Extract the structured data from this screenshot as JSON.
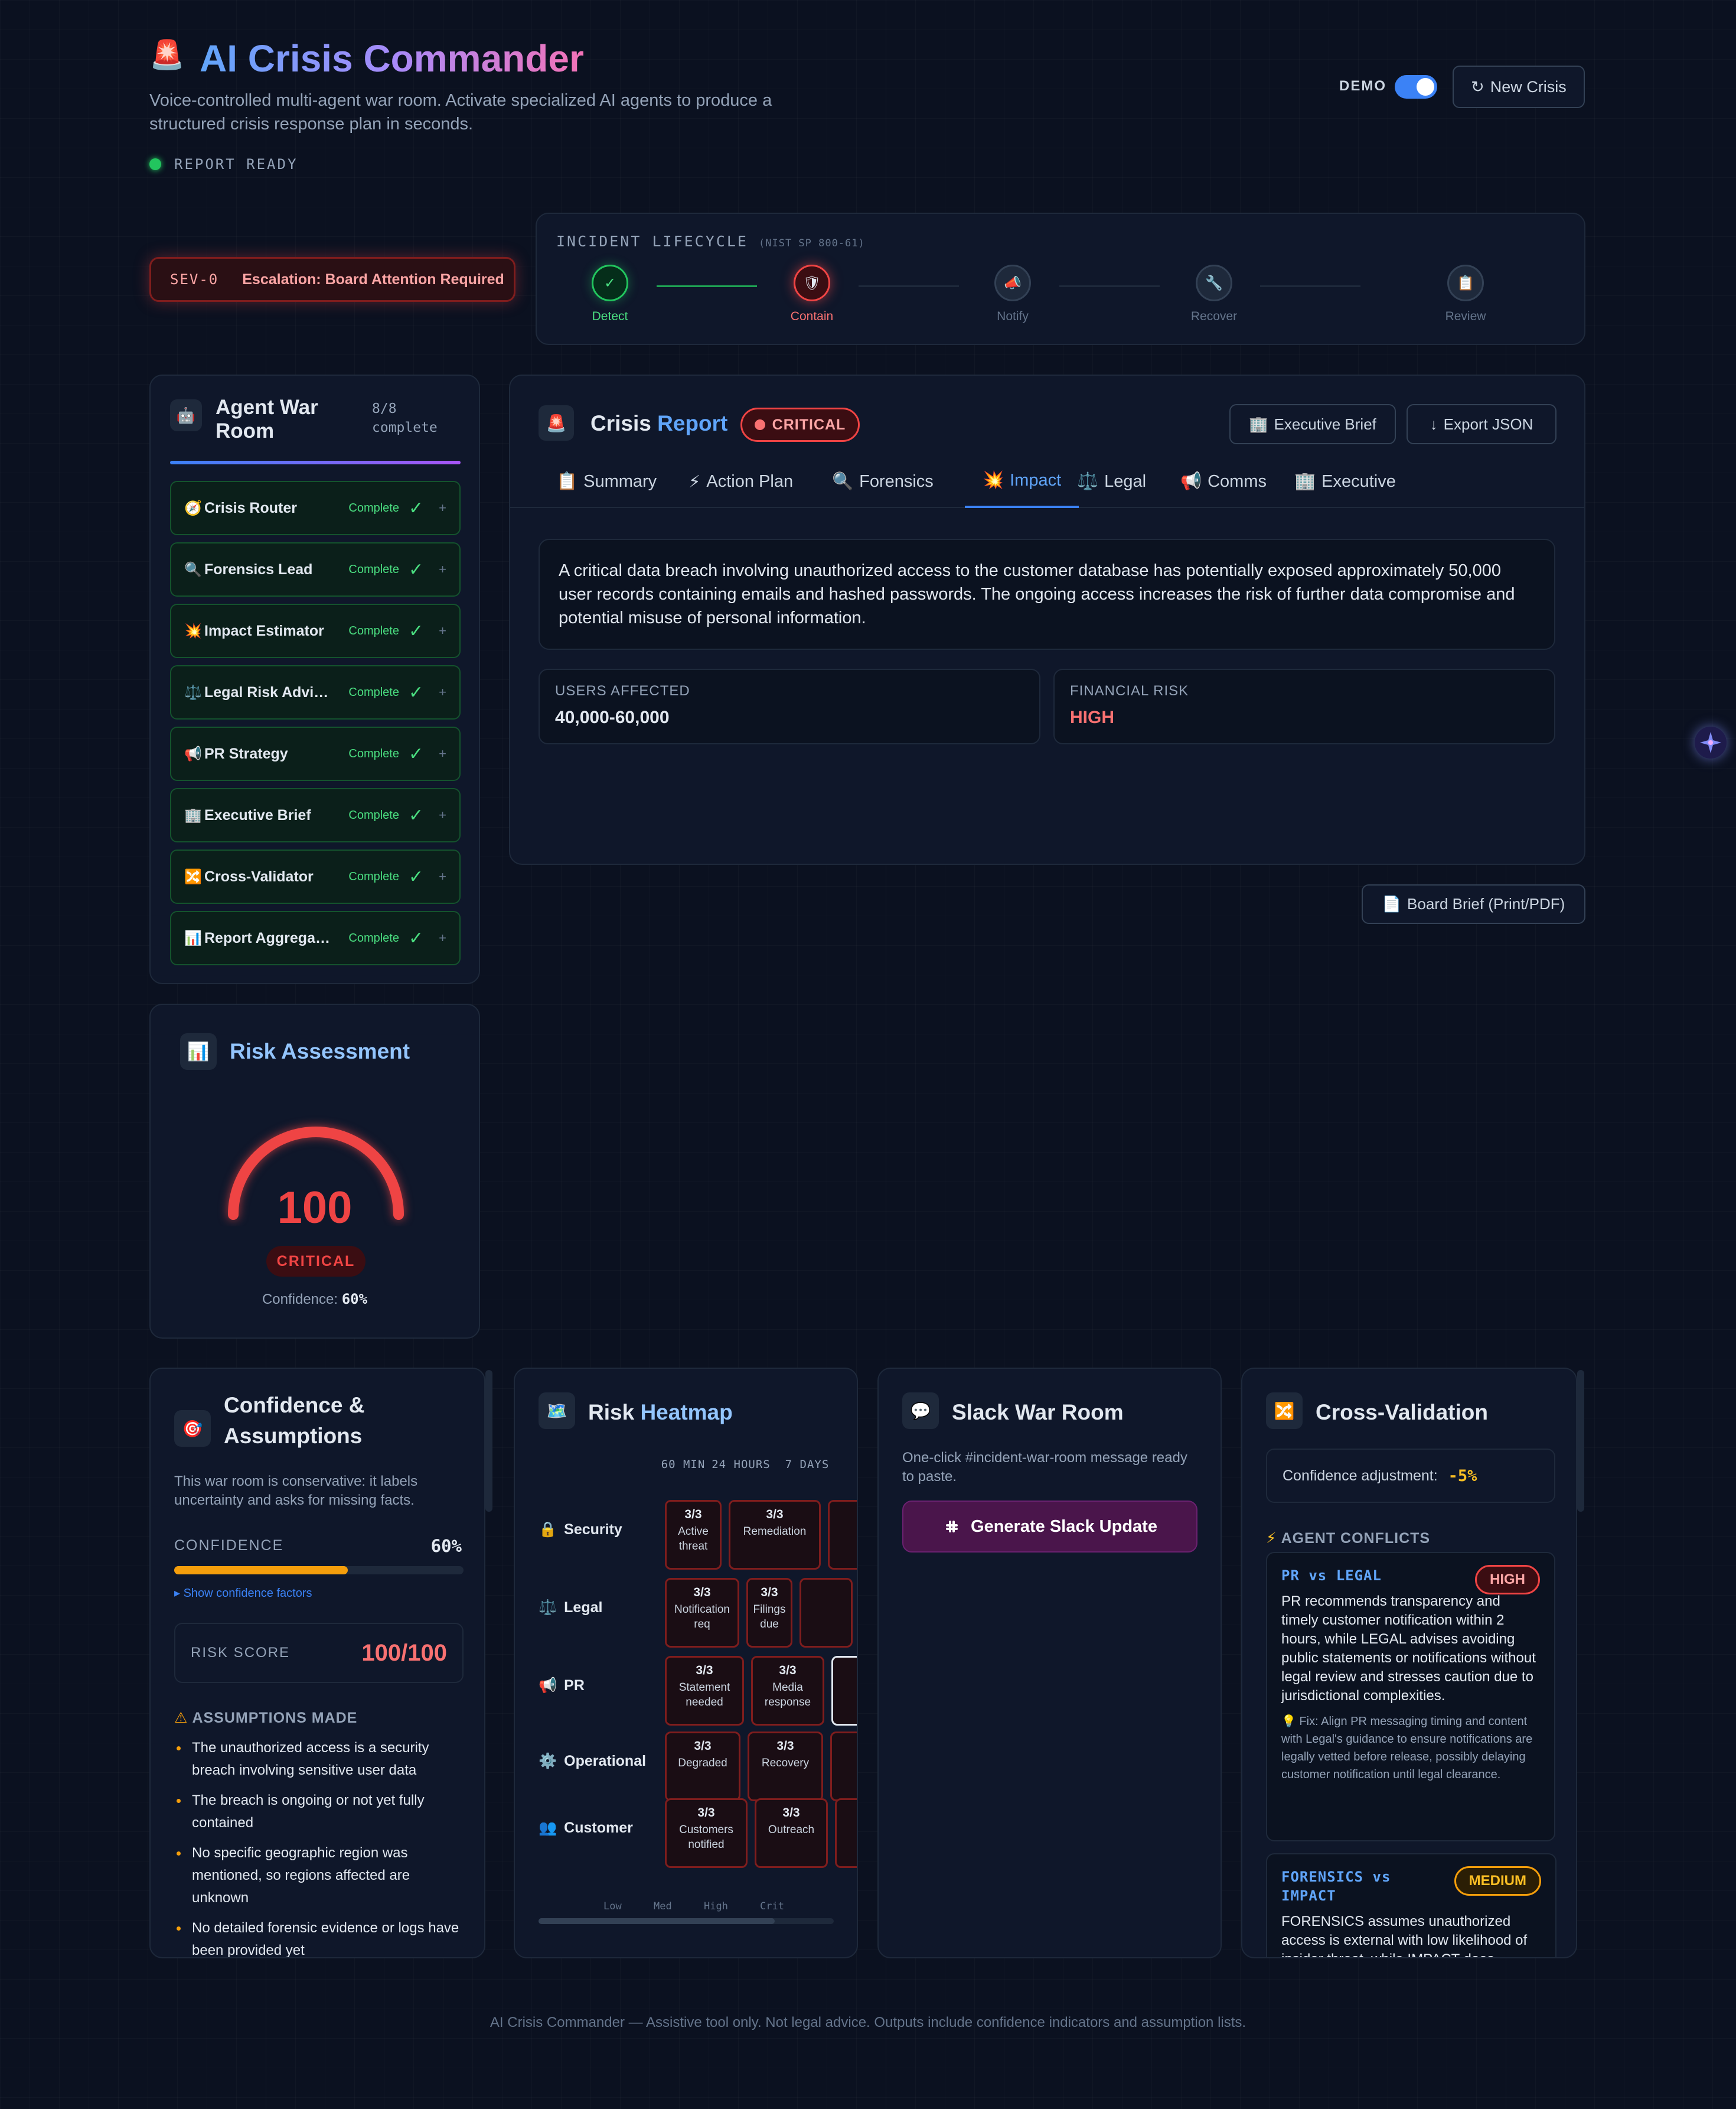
{
  "header": {
    "logo_icon": "🚨",
    "title": "AI Crisis Commander",
    "subtitle": "Voice-controlled multi-agent war room. Activate specialized AI agents to produce a structured crisis response plan in seconds.",
    "status": "REPORT READY",
    "demo_label": "DEMO",
    "new_crisis_label": "New Crisis"
  },
  "severity": {
    "code": "SEV-0",
    "message": "Escalation: Board Attention Required"
  },
  "lifecycle": {
    "title": "INCIDENT LIFECYCLE",
    "subtitle": "(NIST SP 800-61)",
    "steps": [
      {
        "name": "Detect",
        "icon": "✓",
        "state": "done"
      },
      {
        "name": "Contain",
        "icon": "🛡",
        "state": "active"
      },
      {
        "name": "Notify",
        "icon": "📣",
        "state": "pending"
      },
      {
        "name": "Recover",
        "icon": "🔧",
        "state": "pending"
      },
      {
        "name": "Review",
        "icon": "📋",
        "state": "pending"
      }
    ]
  },
  "agents": {
    "title": "Agent War Room",
    "count": "8/8",
    "count_label": "complete",
    "items": [
      {
        "icon": "🧭",
        "name": "Crisis Router",
        "status": "Complete"
      },
      {
        "icon": "🔍",
        "name": "Forensics Lead",
        "status": "Complete"
      },
      {
        "icon": "💥",
        "name": "Impact Estimator",
        "status": "Complete"
      },
      {
        "icon": "⚖️",
        "name": "Legal Risk Advisor",
        "status": "Complete"
      },
      {
        "icon": "📢",
        "name": "PR Strategy",
        "status": "Complete"
      },
      {
        "icon": "🏢",
        "name": "Executive Brief",
        "status": "Complete"
      },
      {
        "icon": "🔀",
        "name": "Cross-Validator",
        "status": "Complete"
      },
      {
        "icon": "📊",
        "name": "Report Aggregator",
        "status": "Complete"
      }
    ]
  },
  "risk": {
    "icon": "📊",
    "title": "Risk Assessment",
    "score": "100",
    "score_fraction": 1.0,
    "level": "CRITICAL",
    "confidence_label": "Confidence:",
    "confidence_value": "60%",
    "color": "#ef4444"
  },
  "report": {
    "icon": "🚨",
    "title_a": "Crisis",
    "title_b": "Report",
    "badge": "CRITICAL",
    "exec_brief_label": "Executive Brief",
    "export_label": "Export JSON",
    "tabs": [
      {
        "icon": "📋",
        "label": "Summary"
      },
      {
        "icon": "⚡",
        "label": "Action Plan"
      },
      {
        "icon": "🔍",
        "label": "Forensics"
      },
      {
        "icon": "💥",
        "label": "Impact"
      },
      {
        "icon": "⚖️",
        "label": "Legal"
      },
      {
        "icon": "📢",
        "label": "Comms"
      },
      {
        "icon": "🏢",
        "label": "Executive"
      }
    ],
    "active_tab": "Impact",
    "summary": "A critical data breach involving unauthorized access to the customer database has potentially exposed approximately 50,000 user records containing emails and hashed passwords. The ongoing access increases the risk of further data compromise and potential misuse of personal information.",
    "metrics": [
      {
        "label": "USERS AFFECTED",
        "value": "40,000-60,000"
      },
      {
        "label": "FINANCIAL RISK",
        "value": "HIGH"
      }
    ],
    "board_brief_label": "Board Brief (Print/PDF)"
  },
  "confidence_card": {
    "icon": "🎯",
    "title": "Confidence & Assumptions",
    "intro": "This war room is conservative: it labels uncertainty and asks for missing facts.",
    "confidence_label": "CONFIDENCE",
    "confidence_value": "60%",
    "confidence_fraction": 0.6,
    "show_factors": "▸ Show confidence factors",
    "risk_score_label": "RISK SCORE",
    "risk_score_value": "100/100",
    "assumptions_title": "ASSUMPTIONS MADE",
    "assumptions": [
      "The unauthorized access is a security breach involving sensitive user data",
      "The breach is ongoing or not yet fully contained",
      "No specific geographic region was mentioned, so regions affected are unknown",
      "No detailed forensic evidence or logs have been provided yet"
    ]
  },
  "heatmap": {
    "icon": "🗺️",
    "title_a": "Risk",
    "title_b": "Heatmap",
    "columns": [
      "60 MIN",
      "24 HOURS",
      "7 DAYS"
    ],
    "rows": [
      {
        "icon": "🔒",
        "label": "Security",
        "cells": [
          {
            "v": "3/3",
            "t": "Active threat"
          },
          {
            "v": "3/3",
            "t": "Remediation"
          }
        ]
      },
      {
        "icon": "⚖️",
        "label": "Legal",
        "cells": [
          {
            "v": "3/3",
            "t": "Notification req"
          },
          {
            "v": "3/3",
            "t": "Filings due"
          }
        ]
      },
      {
        "icon": "📢",
        "label": "PR",
        "cells": [
          {
            "v": "3/3",
            "t": "Statement needed"
          },
          {
            "v": "3/3",
            "t": "Media response"
          }
        ]
      },
      {
        "icon": "⚙️",
        "label": "Operational",
        "cells": [
          {
            "v": "3/3",
            "t": "Degraded"
          },
          {
            "v": "3/3",
            "t": "Recovery"
          }
        ]
      },
      {
        "icon": "👥",
        "label": "Customer",
        "cells": [
          {
            "v": "3/3",
            "t": "Customers notified"
          },
          {
            "v": "3/3",
            "t": "Outreach"
          }
        ]
      }
    ],
    "legend": [
      "Low",
      "Med",
      "High",
      "Crit"
    ]
  },
  "slack": {
    "icon": "💬",
    "title": "Slack War Room",
    "intro": "One-click #incident-war-room message ready to paste.",
    "button": "Generate Slack Update"
  },
  "cross_validation": {
    "icon": "🔀",
    "title": "Cross-Validation",
    "adjust_label": "Confidence adjustment:",
    "adjust_value": "-5%",
    "conflicts_title": "AGENT CONFLICTS",
    "conflicts": [
      {
        "title": "PR vs LEGAL",
        "severity": "HIGH",
        "desc": "PR recommends transparency and timely customer notification within 2 hours, while LEGAL advises avoiding public statements or notifications without legal review and stresses caution due to jurisdictional complexities.",
        "fix": "💡 Fix: Align PR messaging timing and content with Legal's guidance to ensure notifications are legally vetted before release, possibly delaying customer notification until legal clearance."
      },
      {
        "title": "FORENSICS vs IMPACT",
        "severity": "MEDIUM",
        "desc": "FORENSICS assumes unauthorized access is external with low likelihood of insider threat, while IMPACT does",
        "fix": ""
      }
    ]
  },
  "footer": "AI Crisis Commander — Assistive tool only. Not legal advice. Outputs include confidence indicators and assumption lists."
}
